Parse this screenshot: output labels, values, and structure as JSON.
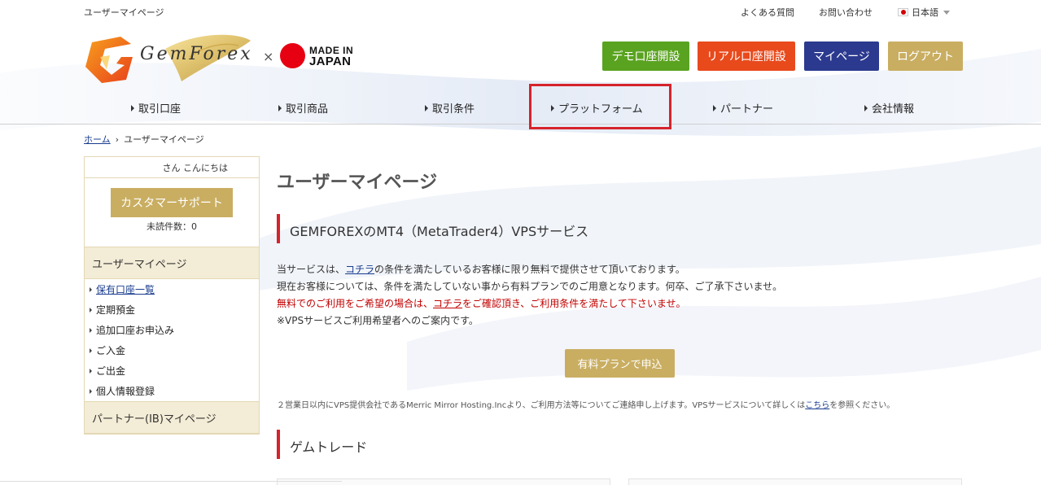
{
  "topbar": {
    "page_name": "ユーザーマイページ",
    "faq": "よくある質問",
    "contact": "お問い合わせ",
    "language": "日本語"
  },
  "header": {
    "brand": "GemForex",
    "times": "×",
    "made_in_line1": "MADE IN",
    "made_in_line2": "JAPAN",
    "buttons": {
      "demo": "デモ口座開設",
      "real": "リアル口座開設",
      "mypage": "マイページ",
      "logout": "ログアウト"
    },
    "colors": {
      "demo": "#5aa320",
      "real": "#e84a1c",
      "mypage": "#2b3a8f",
      "logout": "#c9ae62",
      "highlight": "#d6232b"
    }
  },
  "nav": {
    "items": [
      {
        "label": "取引口座"
      },
      {
        "label": "取引商品"
      },
      {
        "label": "取引条件"
      },
      {
        "label": "プラットフォーム"
      },
      {
        "label": "パートナー"
      },
      {
        "label": "会社情報"
      }
    ]
  },
  "breadcrumb": {
    "home": "ホーム",
    "separator": "›",
    "current": "ユーザーマイページ"
  },
  "sidebar": {
    "greeting": "さん こんにちは",
    "support_button": "カスタマーサポート",
    "unread": "未読件数：0",
    "user_section": "ユーザーマイページ",
    "items": [
      {
        "label": "保有口座一覧"
      },
      {
        "label": "定期預金"
      },
      {
        "label": "追加口座お申込み"
      },
      {
        "label": "ご入金"
      },
      {
        "label": "ご出金"
      },
      {
        "label": "個人情報登録"
      }
    ],
    "partner_section": "パートナー(IB)マイページ"
  },
  "main": {
    "title": "ユーザーマイページ",
    "vps_heading": "GEMFOREXのMT4（MetaTrader4）VPSサービス",
    "desc": {
      "l1_a": "当サービスは、",
      "l1_link": "コチラ",
      "l1_b": "の条件を満たしているお客様に限り無料で提供させて頂いております。",
      "l2": "現在お客様については、条件を満たしていない事から有料プランでのご用意となります。何卒、ご了承下さいませ。",
      "l3_a": "無料でのご利用をご希望の場合は、",
      "l3_link": "コチラ",
      "l3_b": "をご確認頂き、ご利用条件を満たして下さいませ。",
      "l4": "※VPSサービスご利用希望者へのご案内です。"
    },
    "apply_button": "有料プランで申込",
    "note_a": "２営業日以内にVPS提供会社であるMerric Mirror Hosting.Incより、ご利用方法等についてご連絡申し上げます。VPSサービスについて詳しくは",
    "note_link": "こちら",
    "note_b": "を参照ください。",
    "gemtrade_heading": "ゲムトレード"
  }
}
